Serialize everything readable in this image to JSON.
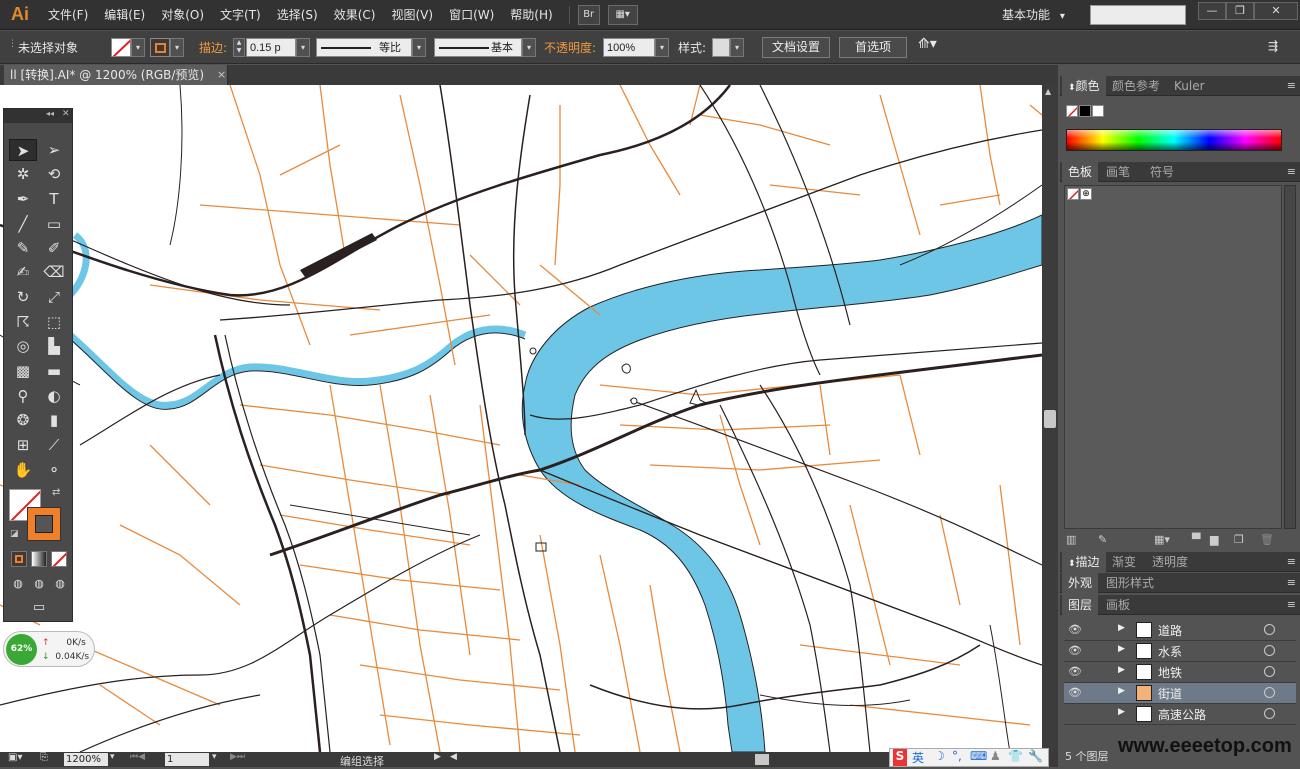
{
  "app": {
    "logo": "Ai",
    "bridge": "Br"
  },
  "menu": [
    "文件(F)",
    "编辑(E)",
    "对象(O)",
    "文字(T)",
    "选择(S)",
    "效果(C)",
    "视图(V)",
    "窗口(W)",
    "帮助(H)"
  ],
  "workspace": {
    "label": "基本功能",
    "arrow": "▾"
  },
  "window_controls": {
    "minimize": "—",
    "restore": "❐",
    "close": "✕"
  },
  "control_bar": {
    "selection": "未选择对象",
    "stroke_label": "描边:",
    "stroke_value": "0.15 p",
    "profile_equal": "等比",
    "profile_basic": "基本",
    "opacity_label": "不透明度:",
    "opacity_value": "100%",
    "style_label": "样式:",
    "doc_setup": "文档设置",
    "preferences": "首选项"
  },
  "document_tab": {
    "title": "ll [转换].AI* @ 1200% (RGB/预览)",
    "close": "×"
  },
  "colors": {
    "river": "#6ec6e6",
    "street": "#e88a3c",
    "road": "#2a2020",
    "stroke_swatch": "#f07f2a"
  },
  "speed_widget": {
    "percent": "62%",
    "up": "0K/s",
    "down": "0.04K/s"
  },
  "panels": {
    "color_tabs": [
      "颜色",
      "颜色参考",
      "Kuler"
    ],
    "swatch_tabs": [
      "色板",
      "画笔",
      "符号"
    ],
    "stroke_tabs": [
      "描边",
      "渐变",
      "透明度"
    ],
    "appearance_tabs": [
      "外观",
      "图形样式"
    ],
    "layer_tabs": [
      "图层",
      "画板"
    ]
  },
  "layers": [
    {
      "name": "道路",
      "visible": true,
      "selected": false
    },
    {
      "name": "水系",
      "visible": true,
      "selected": false
    },
    {
      "name": "地铁",
      "visible": true,
      "selected": false
    },
    {
      "name": "街道",
      "visible": true,
      "selected": true
    },
    {
      "name": "高速公路",
      "visible": false,
      "selected": false
    }
  ],
  "layer_count": "5 个图层",
  "status_bar": {
    "zoom": "1200%",
    "page": "1",
    "status": "编组选择"
  },
  "ime": {
    "logo": "S",
    "lang": "英"
  },
  "watermark": "www.eeeetop.com"
}
